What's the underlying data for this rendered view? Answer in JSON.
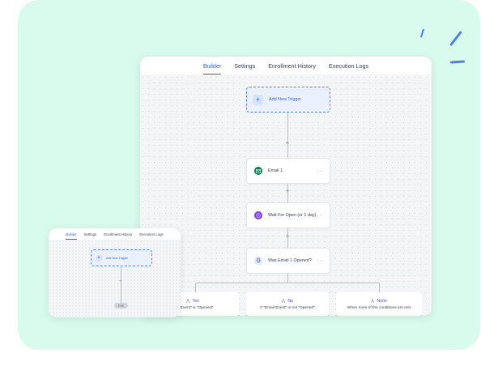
{
  "main_window": {
    "tabs": [
      {
        "label": "Builder",
        "active": true
      },
      {
        "label": "Settings",
        "active": false
      },
      {
        "label": "Enrollment History",
        "active": false
      },
      {
        "label": "Execution Logs",
        "active": false
      }
    ],
    "trigger": {
      "label": "Add New Trigger",
      "icon": "plus-icon"
    },
    "steps": [
      {
        "label": "Email 1",
        "icon": "email-icon",
        "color": "#0f7a4f"
      },
      {
        "label": "Wait For Open (or 1 day)",
        "icon": "clock-icon",
        "color": "#7c3aed"
      },
      {
        "label": "Was Email 1 Opened?",
        "icon": "braces-icon",
        "color": "#2f63d4"
      }
    ],
    "connector_plus": "+",
    "branches": [
      {
        "title": "Yes",
        "subtitle": "mail Event\" is \"Opened\""
      },
      {
        "title": "No",
        "subtitle": "If \"Email Event\" is not \"Opened\""
      },
      {
        "title": "None",
        "subtitle": "When none of the conditions are met"
      }
    ],
    "more_glyph": "···",
    "branch_icon": "split-icon"
  },
  "small_window": {
    "tabs": [
      {
        "label": "Builder",
        "active": true
      },
      {
        "label": "Settings",
        "active": false
      },
      {
        "label": "Enrollment History",
        "active": false
      },
      {
        "label": "Execution Logs",
        "active": false
      }
    ],
    "trigger": {
      "label": "Add New Trigger"
    },
    "connector_plus": "+",
    "end_label": "END"
  },
  "colors": {
    "background_card": "#d9fbee",
    "accent_blue": "#2f63d4",
    "branch_purple": "#7c4ddb"
  }
}
